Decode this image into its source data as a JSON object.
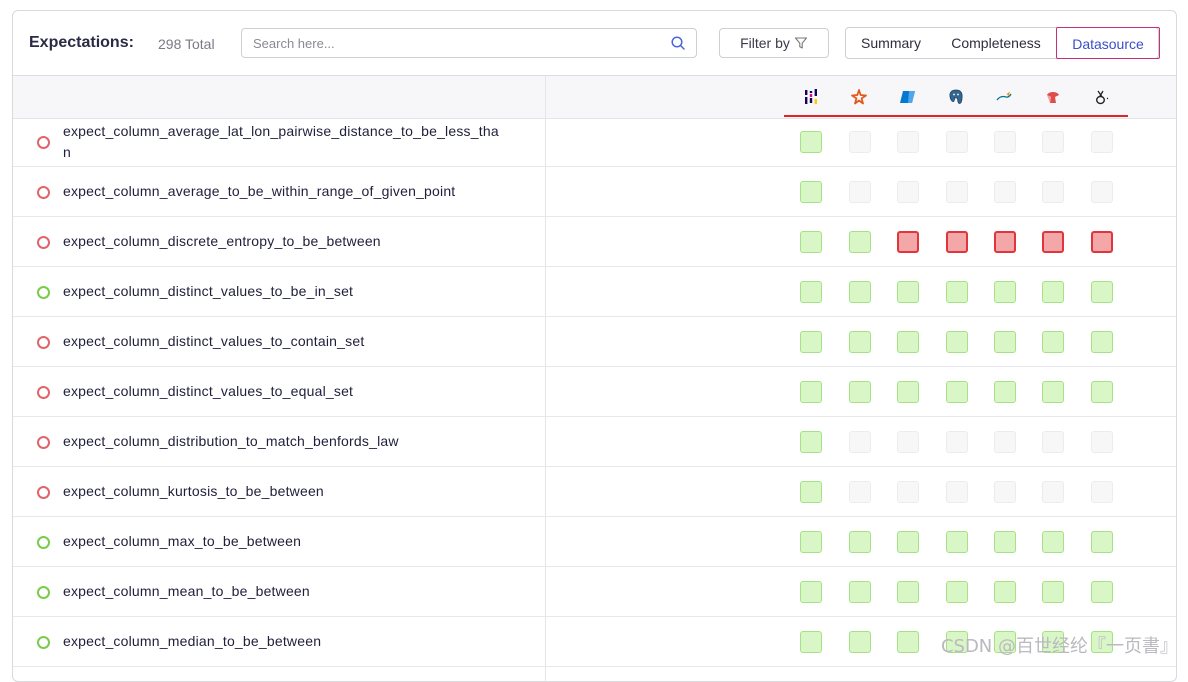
{
  "header": {
    "title": "Expectations:",
    "total": "298 Total",
    "search_placeholder": "Search here...",
    "filter_label": "Filter by",
    "tabs": [
      {
        "label": "Summary",
        "active": false
      },
      {
        "label": "Completeness",
        "active": false
      },
      {
        "label": "Datasource",
        "active": true
      }
    ]
  },
  "datasources": [
    {
      "icon": "pandas-icon",
      "color": "#150458"
    },
    {
      "icon": "spark-icon",
      "color": "#e25a1c"
    },
    {
      "icon": "azure-sql-icon",
      "color": "#0078d4"
    },
    {
      "icon": "postgresql-icon",
      "color": "#336791"
    },
    {
      "icon": "mysql-icon",
      "color": "#00758f"
    },
    {
      "icon": "redshift-icon",
      "color": "#e14d4d"
    },
    {
      "icon": "sqlite-icon",
      "color": "#222222"
    }
  ],
  "colors": {
    "pass_fill": "#d9f6c6",
    "pass_border": "#a6e284",
    "fail_fill": "#f4a7a9",
    "fail_border": "#e0353b",
    "none_fill": "#f7f7f8",
    "accent": "#3b4fc9"
  },
  "rows": [
    {
      "name": "expect_column_average_lat_lon_pairwise_distance_to_be_less_tha",
      "name_cont": "n",
      "status": "red",
      "support": [
        "ok",
        "no",
        "no",
        "no",
        "no",
        "no",
        "no"
      ]
    },
    {
      "name": "expect_column_average_to_be_within_range_of_given_point",
      "status": "red",
      "support": [
        "ok",
        "no",
        "no",
        "no",
        "no",
        "no",
        "no"
      ]
    },
    {
      "name": "expect_column_discrete_entropy_to_be_between",
      "status": "red",
      "support": [
        "ok",
        "ok",
        "fail",
        "fail",
        "fail",
        "fail",
        "fail"
      ]
    },
    {
      "name": "expect_column_distinct_values_to_be_in_set",
      "status": "green",
      "support": [
        "ok",
        "ok",
        "ok",
        "ok",
        "ok",
        "ok",
        "ok"
      ]
    },
    {
      "name": "expect_column_distinct_values_to_contain_set",
      "status": "red",
      "support": [
        "ok",
        "ok",
        "ok",
        "ok",
        "ok",
        "ok",
        "ok"
      ]
    },
    {
      "name": "expect_column_distinct_values_to_equal_set",
      "status": "red",
      "support": [
        "ok",
        "ok",
        "ok",
        "ok",
        "ok",
        "ok",
        "ok"
      ]
    },
    {
      "name": "expect_column_distribution_to_match_benfords_law",
      "status": "red",
      "support": [
        "ok",
        "no",
        "no",
        "no",
        "no",
        "no",
        "no"
      ]
    },
    {
      "name": "expect_column_kurtosis_to_be_between",
      "status": "red",
      "support": [
        "ok",
        "no",
        "no",
        "no",
        "no",
        "no",
        "no"
      ]
    },
    {
      "name": "expect_column_max_to_be_between",
      "status": "green",
      "support": [
        "ok",
        "ok",
        "ok",
        "ok",
        "ok",
        "ok",
        "ok"
      ]
    },
    {
      "name": "expect_column_mean_to_be_between",
      "status": "green",
      "support": [
        "ok",
        "ok",
        "ok",
        "ok",
        "ok",
        "ok",
        "ok"
      ]
    },
    {
      "name": "expect_column_median_to_be_between",
      "status": "green",
      "support": [
        "ok",
        "ok",
        "ok",
        "ok",
        "ok",
        "ok",
        "ok"
      ]
    }
  ],
  "watermark": "CSDN @百世经纶『一页書』"
}
